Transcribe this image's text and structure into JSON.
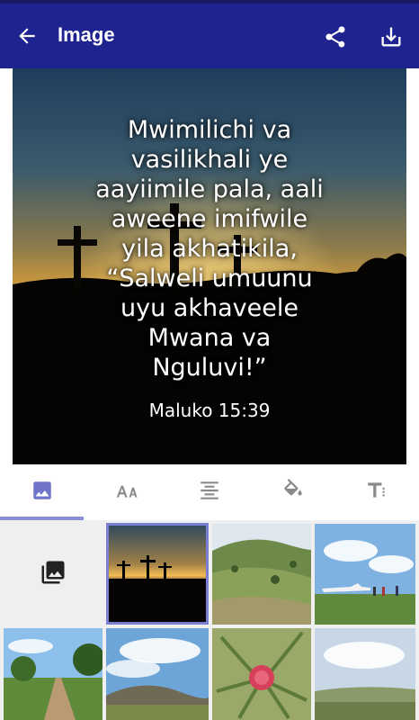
{
  "appbar": {
    "title": "Image",
    "back_icon": "arrow-back-icon",
    "share_icon": "share-icon",
    "download_icon": "download-icon"
  },
  "canvas": {
    "verse": "Mwimilichi va\nvasilikhali ye\naayiimile pala, aali\naweene imifwile\nyila akhatikila,\n“Salweli umuunu\nuyu akhaveele\nMwana va\nNguluvi!”",
    "reference": "Maluko 15:39"
  },
  "tabs": [
    {
      "name": "image",
      "icon": "image-icon",
      "selected": true
    },
    {
      "name": "text-size",
      "icon": "text-size-icon",
      "selected": false
    },
    {
      "name": "align",
      "icon": "align-center-icon",
      "selected": false
    },
    {
      "name": "color",
      "icon": "paint-bucket-icon",
      "selected": false
    },
    {
      "name": "font",
      "icon": "text-format-icon",
      "selected": false
    }
  ],
  "gallery": {
    "picker_icon": "photo-library-icon",
    "tiles": [
      "crosses-sunset",
      "green-hills",
      "airplane-field",
      "dirt-road-trees",
      "hills-clouds",
      "red-flower",
      "landscape-clouds"
    ],
    "selected_tile": "crosses-sunset"
  },
  "colors": {
    "appbar": "#1f2390",
    "statusbar": "#151a63",
    "indicator": "#8a8fd8"
  }
}
